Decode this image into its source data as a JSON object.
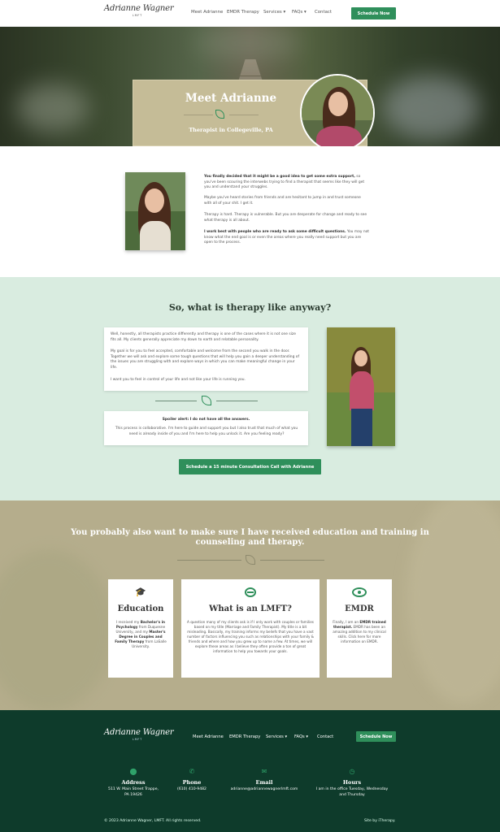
{
  "header": {
    "logo_signature": "Adrianne Wagner",
    "logo_sub": "LMFT",
    "nav": [
      "Meet Adrianne",
      "EMDR Therapy",
      "Services ▾",
      "FAQs ▾",
      "Contact"
    ],
    "cta": "Schedule Now"
  },
  "hero": {
    "title": "Meet Adrianne",
    "subtitle": "Therapist in Collegeville, PA"
  },
  "intro": {
    "p1_bold": "You finally decided that it might be a good idea to get some extra support,",
    "p1_rest": " so you've been scouring the interwebs trying to find a therapist that seems like they will get you and understand your struggles.",
    "p2": "Maybe you've heard stories from friends and are hesitant to jump in and trust someone with all of your shit. I get it.",
    "p3": "Therapy is hard. Therapy is vulnerable. But you are desperate for change and ready to see what therapy is all about.",
    "p4_bold": "I work best with people who are ready to ask some difficult questions.",
    "p4_rest": " You may not know what the end goal is or even the areas where you really need support but you are open to the process."
  },
  "therapy": {
    "heading": "So, what is therapy like anyway?",
    "box1_p1": "Well, honestly, all therapists practice differently and therapy is one of the cases where it is not one size fits all. My clients generally appreciate my down to earth and relatable personality.",
    "box1_p2": "My goal is for you to feel accepted, comfortable and welcome from the second you walk in the door. Together we will ask and explore some tough questions that will help you gain a deeper understanding of the issues you are struggling with and explore ways in which you can make meaningful change in your life.",
    "box1_p3": "I want you to feel in control of your life and not like your life is running you.",
    "box2_title": "Spoiler alert: I do not have all the answers.",
    "box2_text": "This process is collaborative. I'm here to guide and support you but I also trust that much of what you need is already inside of you and I'm here to help you unlock it. Are you feeling ready?",
    "cta": "Schedule a 15 minute Consultation Call with Adrianne"
  },
  "education": {
    "heading": "You probably also want to make sure I have received education and training in counseling and therapy.",
    "cards": [
      {
        "icon": "graduation-cap-icon",
        "title": "Education",
        "t1": "I received my ",
        "b1": "Bachelor's in Psychology",
        "t2": " from Duquesne University, and my ",
        "b2": "Master's Degree in Couples and Family Therapy",
        "t3": " from LaSalle University."
      },
      {
        "icon": "layers-icon",
        "title": "What is an LMFT?",
        "text": "A question many of my clients ask is if I only work with couples or families based on my title (Marriage and Family Therapist). My title is a bit misleading. Basically, my training informs my beliefs that you have a vast number of factors influencing you such as relationships with your family & friends and where and how you grew up to name a few. At times, we will explore these areas as I believe they often provide a ton of great information to help you towards your goals."
      },
      {
        "icon": "eye-icon",
        "title": "EMDR",
        "t1": "Finally, I am an ",
        "b1": "EMDR trained therapist.",
        "t2": " EMDR has been an amazing addition to my clinical skills. Click here for more information on EMDR."
      }
    ]
  },
  "footer": {
    "nav": [
      "Meet Adrianne",
      "EMDR Therapy",
      "Services ▾",
      "FAQs ▾",
      "Contact"
    ],
    "cta": "Schedule Now",
    "cols": [
      {
        "icon": "map-pin-icon",
        "label": "Address",
        "v1": "511 W. Main Street Trappe,",
        "v2": "PA 19426"
      },
      {
        "icon": "phone-icon",
        "label": "Phone",
        "v1": "(610) 410-9482",
        "v2": ""
      },
      {
        "icon": "email-icon",
        "label": "Email",
        "v1": "adrianne@adriannewagnerlmft.com",
        "v2": ""
      },
      {
        "icon": "clock-icon",
        "label": "Hours",
        "v1": "I am in the office Tuesday, Wednesday",
        "v2": "and Thursday"
      }
    ],
    "copyright": "© 2023 Adrianne Wagner, LMFT. All rights reserved.",
    "credit": "Site by iTherapy."
  }
}
